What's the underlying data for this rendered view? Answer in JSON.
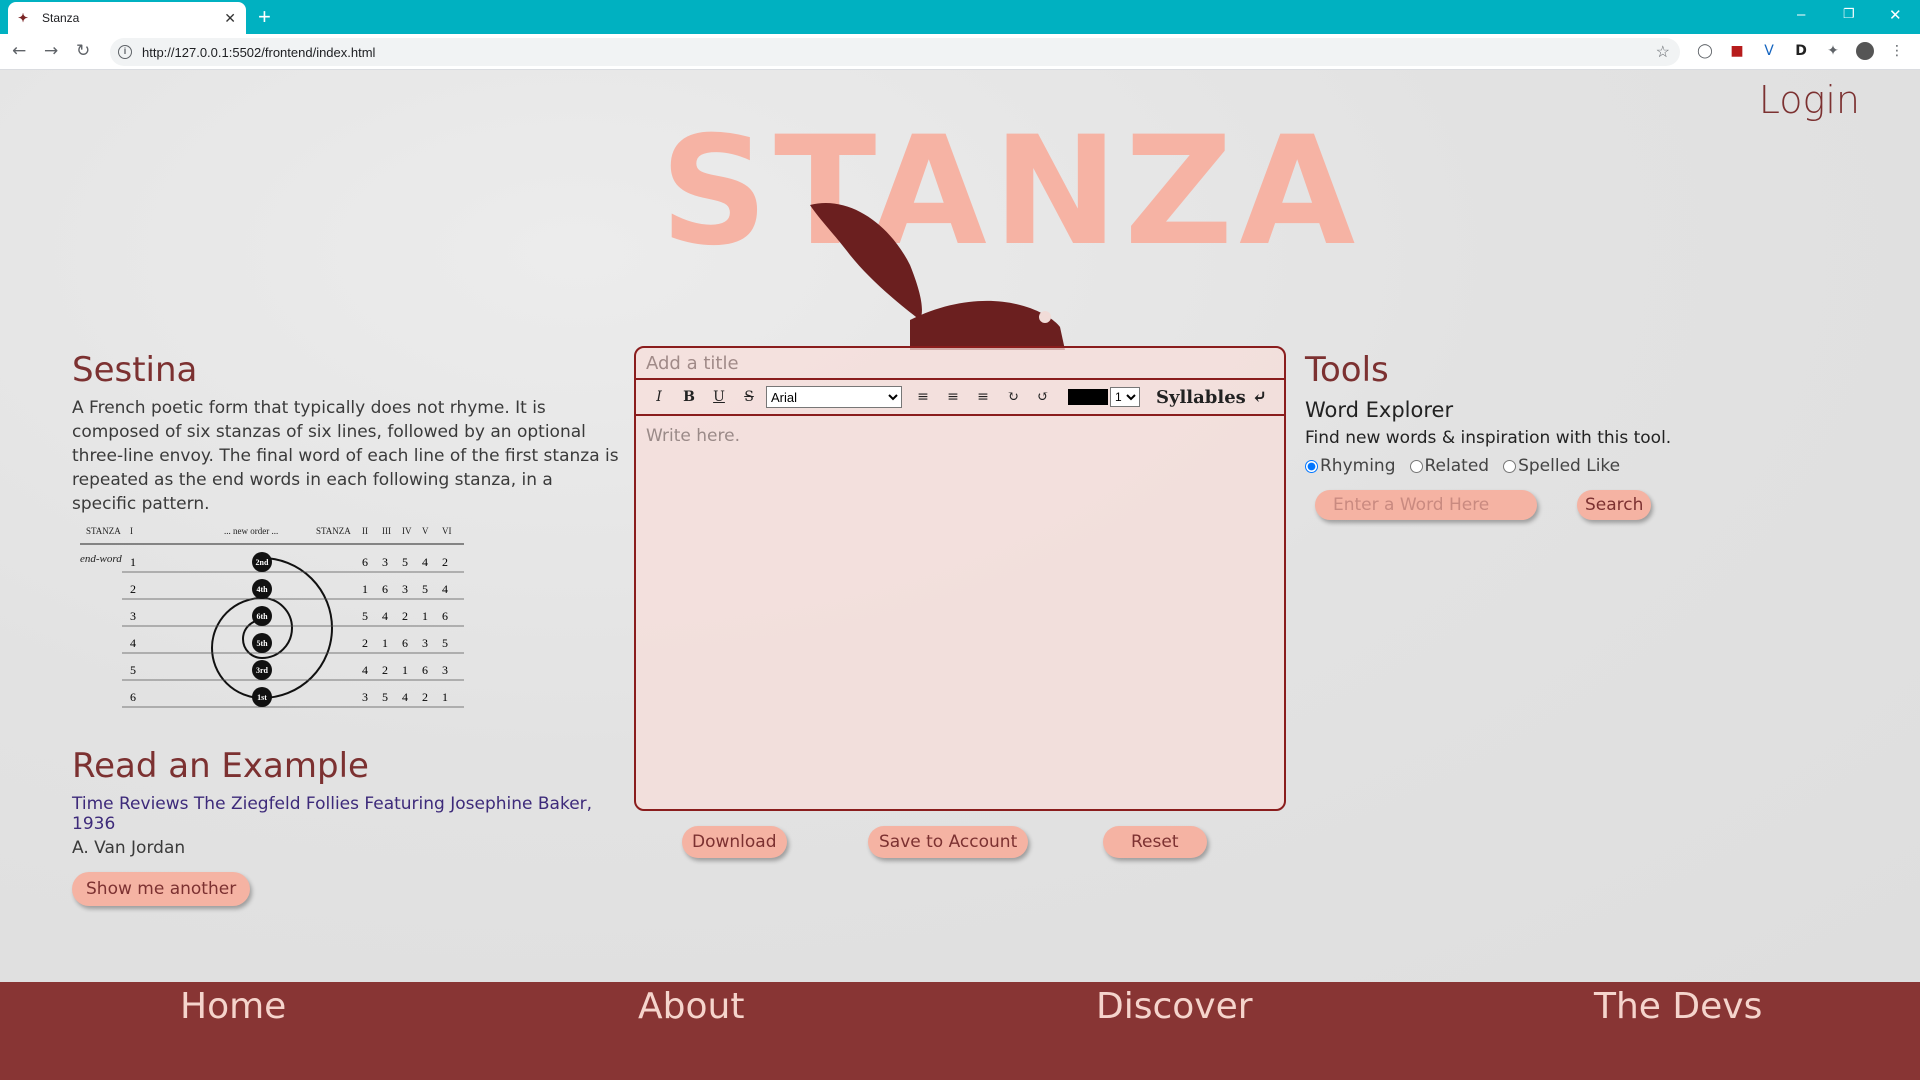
{
  "browser": {
    "tab_title": "Stanza",
    "url": "http://127.0.0.1:5502/frontend/index.html"
  },
  "header": {
    "login": "Login",
    "logo_text": "STANZA"
  },
  "form": {
    "title": "Sestina",
    "description": "A French poetic form that typically does not rhyme. It is composed of six stanzas of six lines, followed by an optional three-line envoy. The final word of each line of the first stanza is repeated as the end words in each following stanza, in a specific pattern.",
    "diagram": {
      "header_stanza": "STANZA",
      "header_i": "I",
      "header_new_order": "... new order ...",
      "header_stanza2": "STANZA",
      "header_cols": [
        "II",
        "III",
        "IV",
        "V",
        "VI"
      ],
      "end_word_label": "end-word",
      "rows": [
        {
          "n": "1",
          "order": "2nd",
          "cols": [
            "6",
            "3",
            "5",
            "4",
            "2"
          ]
        },
        {
          "n": "2",
          "order": "4th",
          "cols": [
            "1",
            "6",
            "3",
            "5",
            "4"
          ]
        },
        {
          "n": "3",
          "order": "6th",
          "cols": [
            "5",
            "4",
            "2",
            "1",
            "6"
          ]
        },
        {
          "n": "4",
          "order": "5th",
          "cols": [
            "2",
            "1",
            "6",
            "3",
            "5"
          ]
        },
        {
          "n": "5",
          "order": "3rd",
          "cols": [
            "4",
            "2",
            "1",
            "6",
            "3"
          ]
        },
        {
          "n": "6",
          "order": "1st",
          "cols": [
            "3",
            "5",
            "4",
            "2",
            "1"
          ]
        }
      ]
    }
  },
  "example": {
    "heading": "Read an Example",
    "link": "Time Reviews The Ziegfeld Follies Featuring Josephine Baker, 1936",
    "author": "A. Van Jordan",
    "button": "Show me another"
  },
  "editor": {
    "title_placeholder": "Add a title",
    "font": "Arial",
    "size": "1",
    "syllables": "Syllables",
    "body_placeholder": "Write here.",
    "download": "Download",
    "save": "Save to Account",
    "reset": "Reset"
  },
  "tools": {
    "heading": "Tools",
    "word_explorer": "Word Explorer",
    "description": "Find new words & inspiration with this tool.",
    "options": [
      "Rhyming",
      "Related",
      "Spelled Like"
    ],
    "selected": "Rhyming",
    "input_placeholder": "Enter a Word Here",
    "search": "Search"
  },
  "footer": {
    "links": [
      "Home",
      "About",
      "Discover",
      "The Devs"
    ]
  },
  "colors": {
    "brand_dark": "#883534",
    "accent_pink": "#f5b3a3",
    "tab_bar": "#00b1c1"
  }
}
